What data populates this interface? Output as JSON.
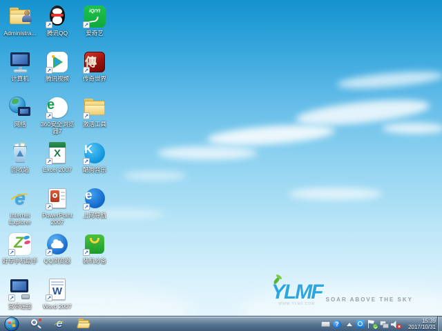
{
  "desktop": {
    "shortcut_glyph": "↗",
    "icons": [
      {
        "name": "administrator-folder",
        "label": "Administra...",
        "type": "user-folder",
        "shortcut": false
      },
      {
        "name": "tencent-qq",
        "label": "腾讯QQ",
        "type": "qq",
        "shortcut": true
      },
      {
        "name": "iqiyi",
        "label": "爱奇艺",
        "type": "iqiyi",
        "glyph": "iQIYI",
        "shortcut": true
      },
      {
        "name": "computer",
        "label": "计算机",
        "type": "computer",
        "shortcut": false
      },
      {
        "name": "tencent-video",
        "label": "腾讯视频",
        "type": "tvideo",
        "shortcut": true
      },
      {
        "name": "legend-of-world",
        "label": "传奇世界",
        "type": "legend",
        "glyph": "傳",
        "shortcut": true
      },
      {
        "name": "network",
        "label": "网络",
        "type": "network",
        "shortcut": false
      },
      {
        "name": "360-safe-browser",
        "label": "360安全浏览器7",
        "type": "e360",
        "glyph": "e",
        "shortcut": true
      },
      {
        "name": "activation-tools",
        "label": "激活工具",
        "type": "folder",
        "shortcut": true
      },
      {
        "name": "recycle-bin",
        "label": "回收站",
        "type": "recycle",
        "shortcut": false
      },
      {
        "name": "excel-2007",
        "label": "Excel 2007",
        "type": "excel",
        "glyph": "X",
        "shortcut": true
      },
      {
        "name": "kugou-music",
        "label": "酷狗音乐",
        "type": "kugou",
        "glyph": "K",
        "shortcut": true
      },
      {
        "name": "internet-explorer",
        "label": "Internet Explorer",
        "type": "ie",
        "glyph": "e",
        "shortcut": false
      },
      {
        "name": "powerpoint-2007",
        "label": "PowerPoint 2007",
        "type": "ppt",
        "shortcut": true
      },
      {
        "name": "web-navigation",
        "label": "上网导航",
        "type": "edge",
        "glyph": "e",
        "shortcut": true
      },
      {
        "name": "phone-assistant",
        "label": "好卓手机助手",
        "type": "assistant",
        "glyph": "Z",
        "shortcut": true
      },
      {
        "name": "qq-browser",
        "label": "QQ浏览器",
        "type": "qqbrowser",
        "shortcut": true
      },
      {
        "name": "software-bundle",
        "label": "装机必备",
        "type": "bag",
        "shortcut": true
      },
      {
        "name": "broadband-connection",
        "label": "宽带连接",
        "type": "broadband",
        "shortcut": true
      },
      {
        "name": "word-2007",
        "label": "Word 2007",
        "type": "word",
        "glyph": "W",
        "shortcut": true
      }
    ]
  },
  "branding": {
    "logo": "YLMF",
    "url": "WWW.YLMF.COM",
    "tagline": "SOAR ABOVE THE SKY",
    "logo_color": "#2ba6de",
    "leaf_color": "#5ab62e"
  },
  "taskbar": {
    "tray": {
      "help_glyph": "?",
      "clock": {
        "time": "15:39",
        "date": "2017/10/31"
      }
    }
  }
}
